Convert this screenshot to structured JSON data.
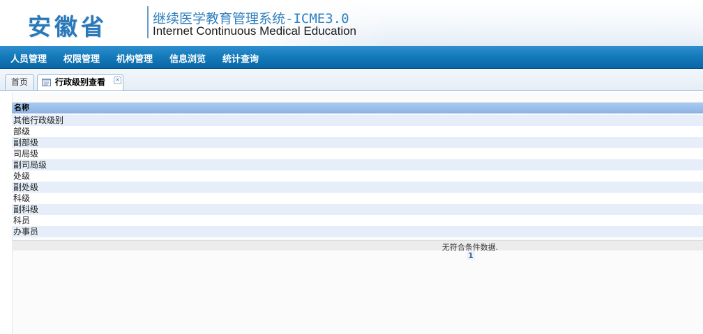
{
  "header": {
    "logo": "安徽省",
    "title_cn": "继续医学教育管理系统-ICME3.0",
    "title_en": "Internet Continuous Medical Education"
  },
  "nav": {
    "items": [
      {
        "label": "人员管理"
      },
      {
        "label": "权限管理"
      },
      {
        "label": "机构管理"
      },
      {
        "label": "信息浏览"
      },
      {
        "label": "统计查询"
      }
    ]
  },
  "tabs": {
    "home": "首页",
    "active": "行政级别查看",
    "close_glyph": "×"
  },
  "grid": {
    "column_header": "名称",
    "rows": [
      "其他行政级别",
      "部级",
      "副部级",
      "司局级",
      "副司局级",
      "处级",
      "副处级",
      "科级",
      "副科级",
      "科员",
      "办事员"
    ],
    "no_data_message": "无符合条件数据.",
    "page_number": "1"
  },
  "colors": {
    "nav_bg": "#157bbb",
    "header_row_bg": "#9fc3ee",
    "alt_row_bg": "#e6eff9",
    "logo_color": "#2a78b8"
  },
  "icons": {
    "tab_icon": "document-list-icon",
    "close_icon": "close-icon"
  }
}
